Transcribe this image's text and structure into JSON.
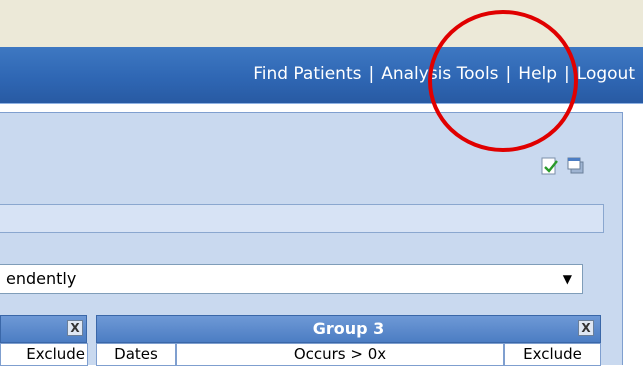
{
  "nav": {
    "links": [
      "Find Patients",
      "Analysis Tools",
      "Help",
      "Logout"
    ],
    "separator": "|"
  },
  "panel": {
    "select_value": "endently",
    "groups": [
      {
        "label": "",
        "header_cells": [
          "Exclude"
        ]
      },
      {
        "label": "Group 3",
        "header_cells": [
          "Dates",
          "Occurs > 0x",
          "Exclude"
        ]
      }
    ],
    "close_glyph": "X"
  },
  "icons": [
    "check-document-icon",
    "window-icon"
  ],
  "colors": {
    "nav": "#2f67b4",
    "panel": "#c9d9ef",
    "group_header": "#5a87c9",
    "highlight_circle": "#e00000"
  }
}
